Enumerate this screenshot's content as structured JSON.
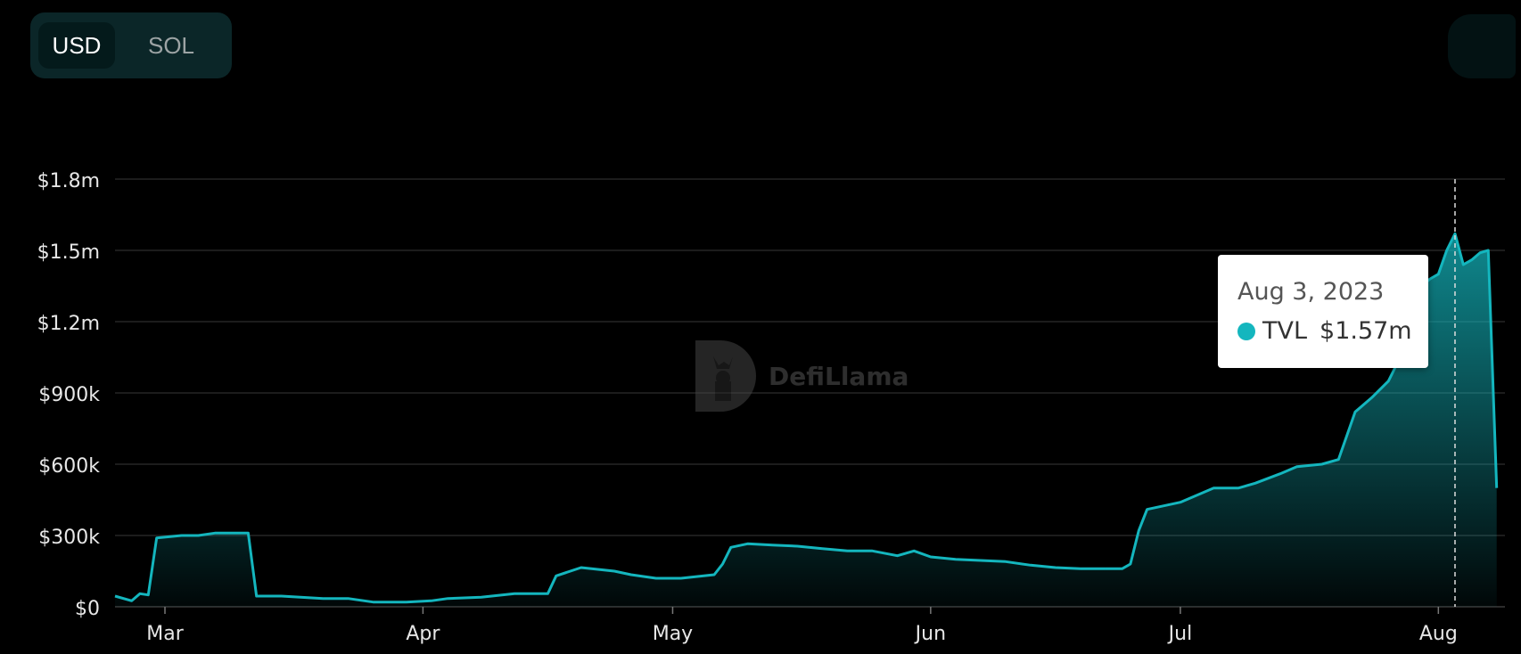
{
  "currency_toggle": {
    "options": [
      {
        "label": "USD",
        "active": true
      },
      {
        "label": "SOL",
        "active": false
      }
    ]
  },
  "watermark": {
    "text": "DefiLlama",
    "icon": "llama-logo-icon"
  },
  "tooltip": {
    "date": "Aug 3, 2023",
    "series": "TVL",
    "value": "$1.57m",
    "marker_color": "#14b6be"
  },
  "chart_data": {
    "type": "area",
    "x_label_dates": [
      "2023-03-01",
      "2023-04-01",
      "2023-05-01",
      "2023-06-01",
      "2023-07-01",
      "2023-08-01"
    ],
    "y_ticks": [
      0,
      300000,
      600000,
      900000,
      1200000,
      1500000,
      1800000
    ],
    "y_tick_labels": [
      "$0",
      "$300k",
      "$600k",
      "$900k",
      "$1.2m",
      "$1.5m",
      "$1.8m"
    ],
    "x_tick_labels": [
      "Mar",
      "Apr",
      "May",
      "Jun",
      "Jul",
      "Aug"
    ],
    "ylim": [
      0,
      1800000
    ],
    "xlim": [
      "2023-02-23",
      "2023-08-09"
    ],
    "grid": true,
    "line_color": "#14b6be",
    "series": [
      {
        "name": "TVL",
        "points": [
          [
            "2023-02-23",
            45000
          ],
          [
            "2023-02-25",
            25000
          ],
          [
            "2023-02-26",
            55000
          ],
          [
            "2023-02-27",
            50000
          ],
          [
            "2023-02-28",
            290000
          ],
          [
            "2023-03-03",
            300000
          ],
          [
            "2023-03-05",
            300000
          ],
          [
            "2023-03-07",
            310000
          ],
          [
            "2023-03-11",
            310000
          ],
          [
            "2023-03-12",
            45000
          ],
          [
            "2023-03-15",
            45000
          ],
          [
            "2023-03-20",
            35000
          ],
          [
            "2023-03-23",
            35000
          ],
          [
            "2023-03-26",
            20000
          ],
          [
            "2023-03-30",
            20000
          ],
          [
            "2023-04-02",
            25000
          ],
          [
            "2023-04-04",
            35000
          ],
          [
            "2023-04-08",
            40000
          ],
          [
            "2023-04-12",
            55000
          ],
          [
            "2023-04-16",
            55000
          ],
          [
            "2023-04-17",
            130000
          ],
          [
            "2023-04-20",
            165000
          ],
          [
            "2023-04-24",
            150000
          ],
          [
            "2023-04-26",
            135000
          ],
          [
            "2023-04-29",
            120000
          ],
          [
            "2023-05-02",
            120000
          ],
          [
            "2023-05-06",
            135000
          ],
          [
            "2023-05-07",
            180000
          ],
          [
            "2023-05-08",
            250000
          ],
          [
            "2023-05-10",
            265000
          ],
          [
            "2023-05-13",
            260000
          ],
          [
            "2023-05-16",
            255000
          ],
          [
            "2023-05-19",
            245000
          ],
          [
            "2023-05-22",
            235000
          ],
          [
            "2023-05-25",
            235000
          ],
          [
            "2023-05-28",
            215000
          ],
          [
            "2023-05-30",
            235000
          ],
          [
            "2023-06-01",
            210000
          ],
          [
            "2023-06-04",
            200000
          ],
          [
            "2023-06-07",
            195000
          ],
          [
            "2023-06-10",
            190000
          ],
          [
            "2023-06-13",
            175000
          ],
          [
            "2023-06-16",
            165000
          ],
          [
            "2023-06-19",
            160000
          ],
          [
            "2023-06-22",
            160000
          ],
          [
            "2023-06-24",
            160000
          ],
          [
            "2023-06-25",
            180000
          ],
          [
            "2023-06-26",
            320000
          ],
          [
            "2023-06-27",
            410000
          ],
          [
            "2023-06-29",
            425000
          ],
          [
            "2023-07-01",
            440000
          ],
          [
            "2023-07-03",
            470000
          ],
          [
            "2023-07-05",
            500000
          ],
          [
            "2023-07-08",
            500000
          ],
          [
            "2023-07-10",
            520000
          ],
          [
            "2023-07-13",
            560000
          ],
          [
            "2023-07-15",
            590000
          ],
          [
            "2023-07-18",
            600000
          ],
          [
            "2023-07-20",
            620000
          ],
          [
            "2023-07-22",
            820000
          ],
          [
            "2023-07-24",
            880000
          ],
          [
            "2023-07-26",
            950000
          ],
          [
            "2023-07-27",
            1020000
          ],
          [
            "2023-07-28",
            1100000
          ],
          [
            "2023-07-29",
            1250000
          ],
          [
            "2023-07-30",
            1350000
          ],
          [
            "2023-07-31",
            1380000
          ],
          [
            "2023-08-01",
            1400000
          ],
          [
            "2023-08-02",
            1500000
          ],
          [
            "2023-08-03",
            1570000
          ],
          [
            "2023-08-04",
            1440000
          ],
          [
            "2023-08-05",
            1460000
          ],
          [
            "2023-08-06",
            1490000
          ],
          [
            "2023-08-07",
            1500000
          ],
          [
            "2023-08-08",
            500000
          ]
        ]
      }
    ],
    "hover_date": "2023-08-03"
  }
}
